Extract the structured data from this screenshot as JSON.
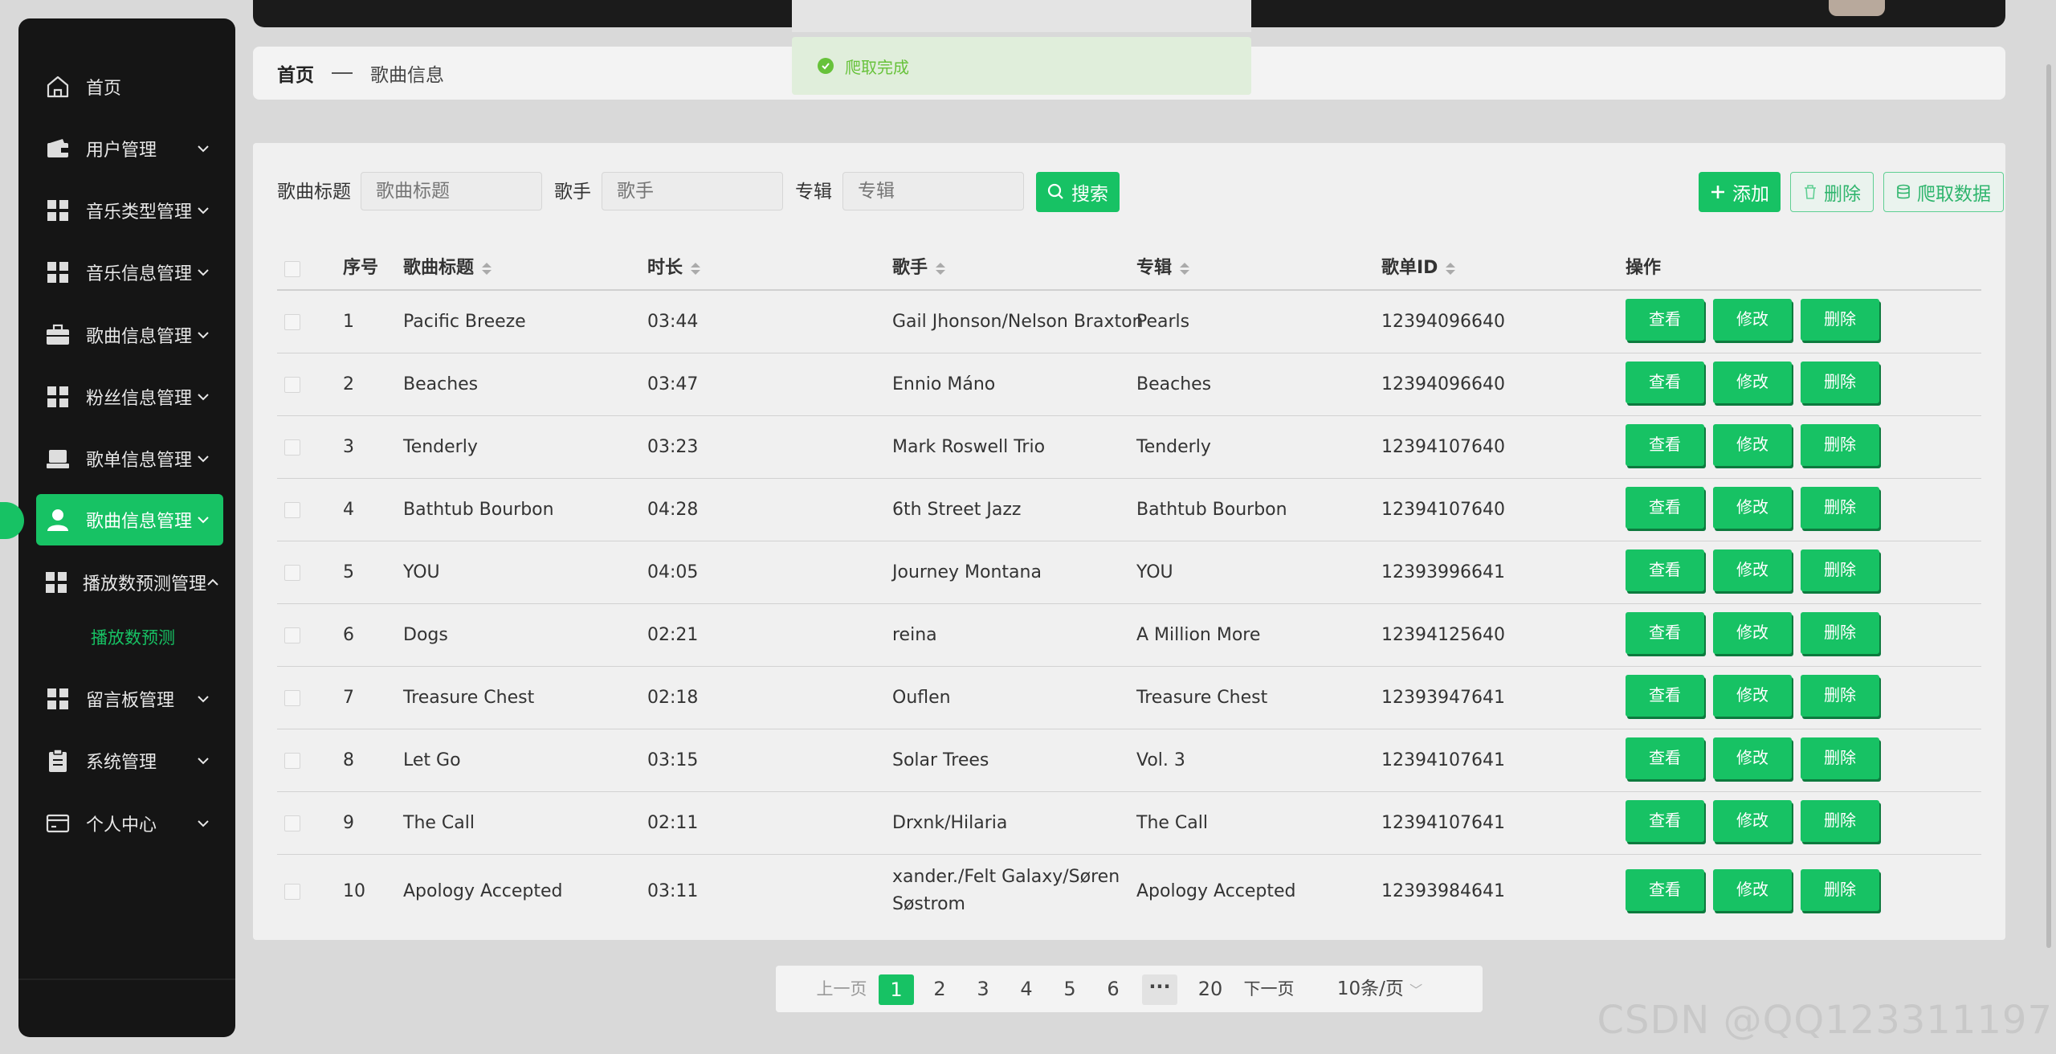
{
  "sidebar": {
    "items": [
      {
        "label": "首页",
        "icon": "home-icon",
        "chevron": false
      },
      {
        "label": "用户管理",
        "icon": "wallet-icon",
        "chevron": true
      },
      {
        "label": "音乐类型管理",
        "icon": "grid-icon",
        "chevron": true
      },
      {
        "label": "音乐信息管理",
        "icon": "grid-icon",
        "chevron": true
      },
      {
        "label": "歌曲信息管理",
        "icon": "briefcase-icon",
        "chevron": true
      },
      {
        "label": "粉丝信息管理",
        "icon": "grid-icon",
        "chevron": true
      },
      {
        "label": "歌单信息管理",
        "icon": "laptop-icon",
        "chevron": true
      },
      {
        "label": "歌曲信息管理",
        "icon": "user-icon",
        "chevron": true,
        "active": true
      },
      {
        "label": "播放数预测管理",
        "icon": "grid-icon",
        "chevron": true,
        "expanded": true
      },
      {
        "label": "留言板管理",
        "icon": "grid-icon",
        "chevron": true
      },
      {
        "label": "系统管理",
        "icon": "clipboard-icon",
        "chevron": true
      },
      {
        "label": "个人中心",
        "icon": "card-icon",
        "chevron": true
      }
    ],
    "subitem": "播放数预测"
  },
  "breadcrumb": {
    "home": "首页",
    "current": "歌曲信息"
  },
  "toast": {
    "text": "爬取完成"
  },
  "search": {
    "title_label": "歌曲标题",
    "title_placeholder": "歌曲标题",
    "singer_label": "歌手",
    "singer_placeholder": "歌手",
    "album_label": "专辑",
    "album_placeholder": "专辑",
    "search_button": "搜索"
  },
  "actions": {
    "add": "添加",
    "delete": "删除",
    "crawl": "爬取数据"
  },
  "table": {
    "headers": {
      "index": "序号",
      "title": "歌曲标题",
      "duration": "时长",
      "singer": "歌手",
      "album": "专辑",
      "playlist_id": "歌单ID",
      "ops": "操作"
    },
    "row_buttons": {
      "view": "查看",
      "edit": "修改",
      "delete": "删除"
    },
    "rows": [
      {
        "index": "1",
        "title": "Pacific Breeze",
        "duration": "03:44",
        "singer": "Gail Jhonson/Nelson Braxton",
        "album": "Pearls",
        "playlist_id": "12394096640"
      },
      {
        "index": "2",
        "title": "Beaches",
        "duration": "03:47",
        "singer": "Ennio Máno",
        "album": "Beaches",
        "playlist_id": "12394096640"
      },
      {
        "index": "3",
        "title": "Tenderly",
        "duration": "03:23",
        "singer": "Mark Roswell Trio",
        "album": "Tenderly",
        "playlist_id": "12394107640"
      },
      {
        "index": "4",
        "title": "Bathtub Bourbon",
        "duration": "04:28",
        "singer": "6th Street Jazz",
        "album": "Bathtub Bourbon",
        "playlist_id": "12394107640"
      },
      {
        "index": "5",
        "title": "YOU",
        "duration": "04:05",
        "singer": "Journey Montana",
        "album": "YOU",
        "playlist_id": "12393996641"
      },
      {
        "index": "6",
        "title": "Dogs",
        "duration": "02:21",
        "singer": "reina",
        "album": "A Million More",
        "playlist_id": "12394125640"
      },
      {
        "index": "7",
        "title": "Treasure Chest",
        "duration": "02:18",
        "singer": "Ouflen",
        "album": "Treasure Chest",
        "playlist_id": "12393947641"
      },
      {
        "index": "8",
        "title": "Let Go",
        "duration": "03:15",
        "singer": "Solar Trees",
        "album": "Vol. 3",
        "playlist_id": "12394107641"
      },
      {
        "index": "9",
        "title": "The Call",
        "duration": "02:11",
        "singer": "Drxnk/Hilaria",
        "album": "The Call",
        "playlist_id": "12394107641"
      },
      {
        "index": "10",
        "title": "Apology Accepted",
        "duration": "03:11",
        "singer": "xander./Felt Galaxy/Søren Søstrom",
        "album": "Apology Accepted",
        "playlist_id": "12393984641"
      }
    ]
  },
  "pagination": {
    "prev": "上一页",
    "next": "下一页",
    "pages": [
      "1",
      "2",
      "3",
      "4",
      "5",
      "6"
    ],
    "current": "1",
    "ellipsis": "···",
    "last": "20",
    "page_size": "10条/页"
  },
  "watermark": "CSDN @QQ123311197",
  "colors": {
    "accent": "#17c264",
    "sidebar_bg": "#151515",
    "toast_text": "#67c23a"
  }
}
